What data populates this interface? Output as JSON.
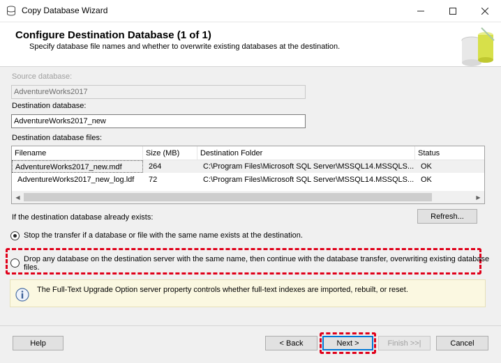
{
  "window": {
    "title": "Copy Database Wizard",
    "minimize_icon": "minimize-icon",
    "maximize_icon": "maximize-icon",
    "close_icon": "close-icon"
  },
  "header": {
    "title": "Configure Destination Database (1 of 1)",
    "subtitle": "Specify database file names and whether to overwrite existing databases at the destination."
  },
  "source": {
    "label": "Source database:",
    "value": "AdventureWorks2017"
  },
  "destination": {
    "label": "Destination database:",
    "value": "AdventureWorks2017_new"
  },
  "files": {
    "label": "Destination database files:",
    "columns": [
      "Filename",
      "Size (MB)",
      "Destination Folder",
      "Status"
    ],
    "rows": [
      [
        "AdventureWorks2017_new.mdf",
        "264",
        "C:\\Program Files\\Microsoft SQL Server\\MSSQL14.MSSQLS...",
        "OK"
      ],
      [
        "AdventureWorks2017_new_log.ldf",
        "72",
        "C:\\Program Files\\Microsoft SQL Server\\MSSQL14.MSSQLS...",
        "OK"
      ]
    ]
  },
  "exists": {
    "label": "If the destination database already exists:",
    "refresh_label": "Refresh...",
    "option_stop": "Stop the transfer if a database or file with the same name exists at the destination.",
    "option_drop_line1": "Drop any database on the destination server with the same name, then continue with the database transfer, overwriting existing database",
    "option_drop_line2": "files.",
    "selected": "stop"
  },
  "info": {
    "text": "The Full-Text Upgrade Option server property controls whether full-text indexes are imported, rebuilt, or reset."
  },
  "footer": {
    "help": "Help",
    "back": "< Back",
    "next": "Next >",
    "finish": "Finish >>|",
    "cancel": "Cancel"
  },
  "colors": {
    "highlight": "#e0001a",
    "accent": "#0078d7",
    "info_bg": "#fbf8e1"
  }
}
